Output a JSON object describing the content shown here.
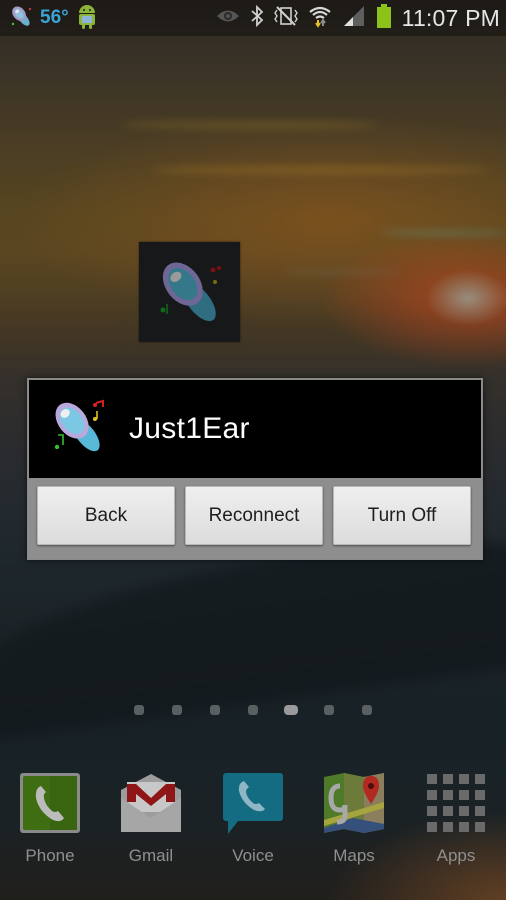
{
  "status_bar": {
    "notifications": [
      {
        "icon": "just1ear-notification-icon"
      },
      {
        "icon": "weather-temperature",
        "text": "56°"
      },
      {
        "icon": "android-robot-icon"
      }
    ],
    "system_icons": [
      "eye-icon",
      "bluetooth-icon",
      "vibrate-mute-icon",
      "wifi-icon",
      "signal-icon",
      "battery-icon"
    ],
    "time": "11:07 PM",
    "battery_color": "#8cc21a"
  },
  "home_widget": {
    "icon": "just1ear-app-icon"
  },
  "dialog": {
    "title": "Just1Ear",
    "buttons": [
      {
        "label": "Back"
      },
      {
        "label": "Reconnect"
      },
      {
        "label": "Turn Off"
      }
    ]
  },
  "page_indicator": {
    "count": 7,
    "active_index": 4
  },
  "dock": [
    {
      "label": "Phone",
      "icon": "phone-icon"
    },
    {
      "label": "Gmail",
      "icon": "gmail-icon"
    },
    {
      "label": "Voice",
      "icon": "voice-icon"
    },
    {
      "label": "Maps",
      "icon": "maps-icon"
    },
    {
      "label": "Apps",
      "icon": "apps-grid-icon"
    }
  ]
}
